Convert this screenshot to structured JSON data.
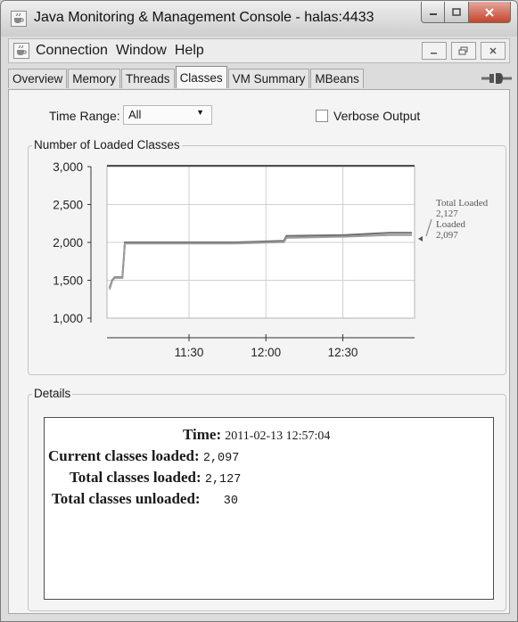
{
  "window": {
    "title": "Java Monitoring & Management Console - halas:4433"
  },
  "menubar": {
    "items": [
      "Connection",
      "Window",
      "Help"
    ]
  },
  "tabs": [
    {
      "label": "Overview"
    },
    {
      "label": "Memory"
    },
    {
      "label": "Threads"
    },
    {
      "label": "Classes",
      "active": true
    },
    {
      "label": "VM Summary"
    },
    {
      "label": "MBeans"
    }
  ],
  "controls": {
    "time_range_label": "Time Range:",
    "time_range_value": "All",
    "verbose_label": "Verbose Output",
    "verbose_checked": false
  },
  "chart_data": {
    "type": "line",
    "title": "Number of Loaded Classes",
    "x_ticks": [
      "11:30",
      "12:00",
      "12:30"
    ],
    "y_ticks": [
      "3,000",
      "2,500",
      "2,000",
      "1,500",
      "1,000"
    ],
    "ylim": [
      1000,
      3000
    ],
    "grid": true,
    "series": [
      {
        "name": "Total Loaded",
        "current": "2,127",
        "color": "#6e6e6e",
        "points": [
          [
            "10:59",
            1400
          ],
          [
            "11:00",
            1500
          ],
          [
            "11:01",
            1540
          ],
          [
            "11:04",
            1540
          ],
          [
            "11:05",
            2000
          ],
          [
            "11:48",
            2000
          ],
          [
            "12:07",
            2020
          ],
          [
            "12:08",
            2085
          ],
          [
            "12:30",
            2095
          ],
          [
            "12:48",
            2127
          ],
          [
            "12:57",
            2127
          ]
        ]
      },
      {
        "name": "Loaded",
        "current": "2,097",
        "color": "#9a9a9a",
        "points": [
          [
            "10:59",
            1380
          ],
          [
            "11:00",
            1490
          ],
          [
            "11:01",
            1530
          ],
          [
            "11:04",
            1530
          ],
          [
            "11:05",
            1985
          ],
          [
            "11:48",
            1985
          ],
          [
            "12:07",
            2005
          ],
          [
            "12:08",
            2060
          ],
          [
            "12:30",
            2075
          ],
          [
            "12:48",
            2097
          ],
          [
            "12:57",
            2097
          ]
        ]
      }
    ]
  },
  "details": {
    "group_title": "Details",
    "time_label": "Time:",
    "time_value": "2011-02-13 12:57:04",
    "current_label": "Current classes loaded:",
    "current_value": "2,097",
    "total_label": "Total classes loaded:",
    "total_value": "2,127",
    "unloaded_label": "Total classes unloaded:",
    "unloaded_value": "30"
  }
}
